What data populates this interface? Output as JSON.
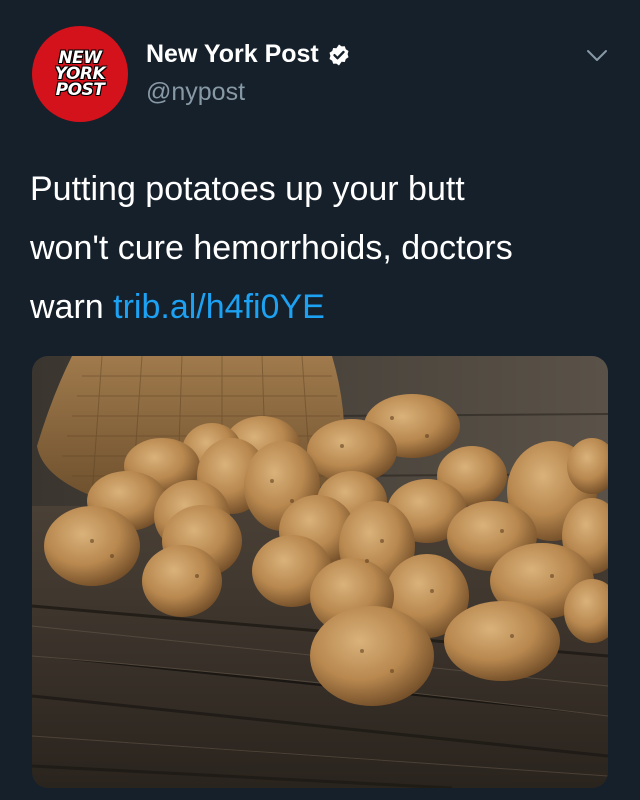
{
  "account": {
    "display_name": "New York Post",
    "handle": "@nypost",
    "verified": true,
    "avatar_logo_lines": [
      "NEW",
      "YORK",
      "POST"
    ],
    "avatar_color": "#d3121b"
  },
  "tweet": {
    "text_line_1": "Putting potatoes up your butt",
    "text_line_2": "won't cure hemorrhoids, doctors",
    "text_line_3_prefix": "warn ",
    "link": "trib.al/h4fi0YE"
  },
  "media": {
    "icon": "potatoes-photo",
    "subject": "pile of potatoes with burlap sack on wooden table"
  },
  "theme": {
    "background": "#15202b",
    "secondary_text": "#8899a6",
    "link_color": "#1da1f2",
    "verified_color": "#ffffff"
  }
}
